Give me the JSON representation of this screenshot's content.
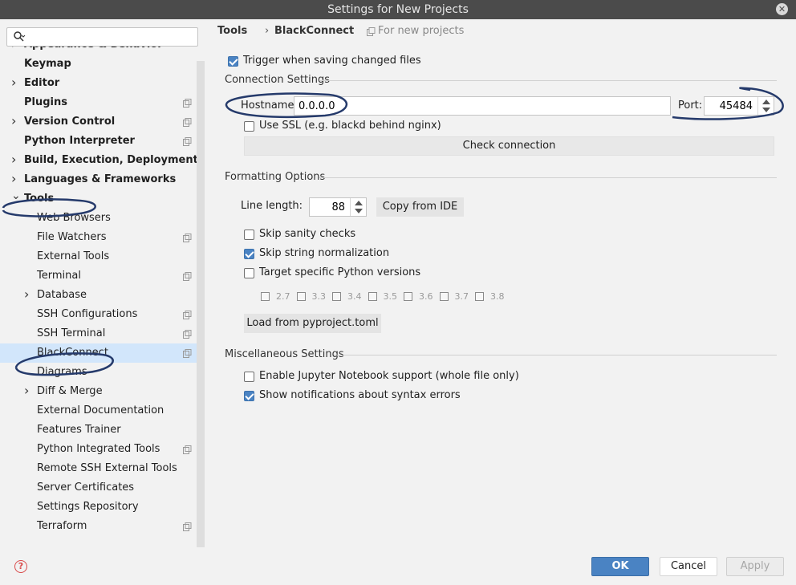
{
  "window": {
    "title": "Settings for New Projects"
  },
  "search": {
    "placeholder": "",
    "value": ""
  },
  "tree": [
    {
      "label": "Appearance & Behavior",
      "level": 0,
      "expandable": true,
      "bold": true,
      "copy": false,
      "partial": true
    },
    {
      "label": "Keymap",
      "level": 0,
      "expandable": false,
      "bold": true,
      "copy": false
    },
    {
      "label": "Editor",
      "level": 0,
      "expandable": true,
      "bold": true,
      "copy": false
    },
    {
      "label": "Plugins",
      "level": 0,
      "expandable": false,
      "bold": true,
      "copy": true
    },
    {
      "label": "Version Control",
      "level": 0,
      "expandable": true,
      "bold": true,
      "copy": true
    },
    {
      "label": "Python Interpreter",
      "level": 0,
      "expandable": false,
      "bold": true,
      "copy": true
    },
    {
      "label": "Build, Execution, Deployment",
      "level": 0,
      "expandable": true,
      "bold": true,
      "copy": false
    },
    {
      "label": "Languages & Frameworks",
      "level": 0,
      "expandable": true,
      "bold": true,
      "copy": false
    },
    {
      "label": "Tools",
      "level": 0,
      "expandable": true,
      "expanded": true,
      "bold": true,
      "copy": false
    },
    {
      "label": "Web Browsers",
      "level": 1,
      "expandable": false,
      "copy": false
    },
    {
      "label": "File Watchers",
      "level": 1,
      "expandable": false,
      "copy": true
    },
    {
      "label": "External Tools",
      "level": 1,
      "expandable": false,
      "copy": false
    },
    {
      "label": "Terminal",
      "level": 1,
      "expandable": false,
      "copy": true
    },
    {
      "label": "Database",
      "level": 1,
      "expandable": true,
      "copy": false
    },
    {
      "label": "SSH Configurations",
      "level": 1,
      "expandable": false,
      "copy": true
    },
    {
      "label": "SSH Terminal",
      "level": 1,
      "expandable": false,
      "copy": true
    },
    {
      "label": "BlackConnect",
      "level": 1,
      "expandable": false,
      "copy": true,
      "selected": true
    },
    {
      "label": "Diagrams",
      "level": 1,
      "expandable": false,
      "copy": false
    },
    {
      "label": "Diff & Merge",
      "level": 1,
      "expandable": true,
      "copy": false
    },
    {
      "label": "External Documentation",
      "level": 1,
      "expandable": false,
      "copy": false
    },
    {
      "label": "Features Trainer",
      "level": 1,
      "expandable": false,
      "copy": false
    },
    {
      "label": "Python Integrated Tools",
      "level": 1,
      "expandable": false,
      "copy": true
    },
    {
      "label": "Remote SSH External Tools",
      "level": 1,
      "expandable": false,
      "copy": false
    },
    {
      "label": "Server Certificates",
      "level": 1,
      "expandable": false,
      "copy": false
    },
    {
      "label": "Settings Repository",
      "level": 1,
      "expandable": false,
      "copy": false
    },
    {
      "label": "Terraform",
      "level": 1,
      "expandable": false,
      "copy": true
    }
  ],
  "breadcrumb": {
    "parent": "Tools",
    "current": "BlackConnect",
    "scope": "For new projects",
    "separator": "›"
  },
  "trigger": {
    "label": "Trigger when saving changed files",
    "checked": true
  },
  "connection": {
    "title": "Connection Settings",
    "hostname_label": "Hostname:",
    "hostname_value": "0.0.0.0",
    "port_label": "Port:",
    "port_value": "45484",
    "ssl_label": "Use SSL (e.g. blackd behind nginx)",
    "ssl_checked": false,
    "check_button": "Check connection"
  },
  "formatting": {
    "title": "Formatting Options",
    "line_length_label": "Line length:",
    "line_length_value": "88",
    "copy_button": "Copy from IDE",
    "skip_sanity": {
      "label": "Skip sanity checks",
      "checked": false
    },
    "skip_string": {
      "label": "Skip string normalization",
      "checked": true
    },
    "target_versions": {
      "label": "Target specific Python versions",
      "checked": false
    },
    "versions": [
      "2.7",
      "3.3",
      "3.4",
      "3.5",
      "3.6",
      "3.7",
      "3.8"
    ],
    "load_button": "Load from pyproject.toml"
  },
  "misc": {
    "title": "Miscellaneous Settings",
    "jupyter": {
      "label": "Enable Jupyter Notebook support (whole file only)",
      "checked": false
    },
    "notifications": {
      "label": "Show notifications about syntax errors",
      "checked": true
    }
  },
  "buttons": {
    "ok": "OK",
    "cancel": "Cancel",
    "apply": "Apply"
  },
  "colors": {
    "accent": "#4a83c3",
    "selection": "#d2e6fb",
    "annotation": "#253a6b"
  }
}
